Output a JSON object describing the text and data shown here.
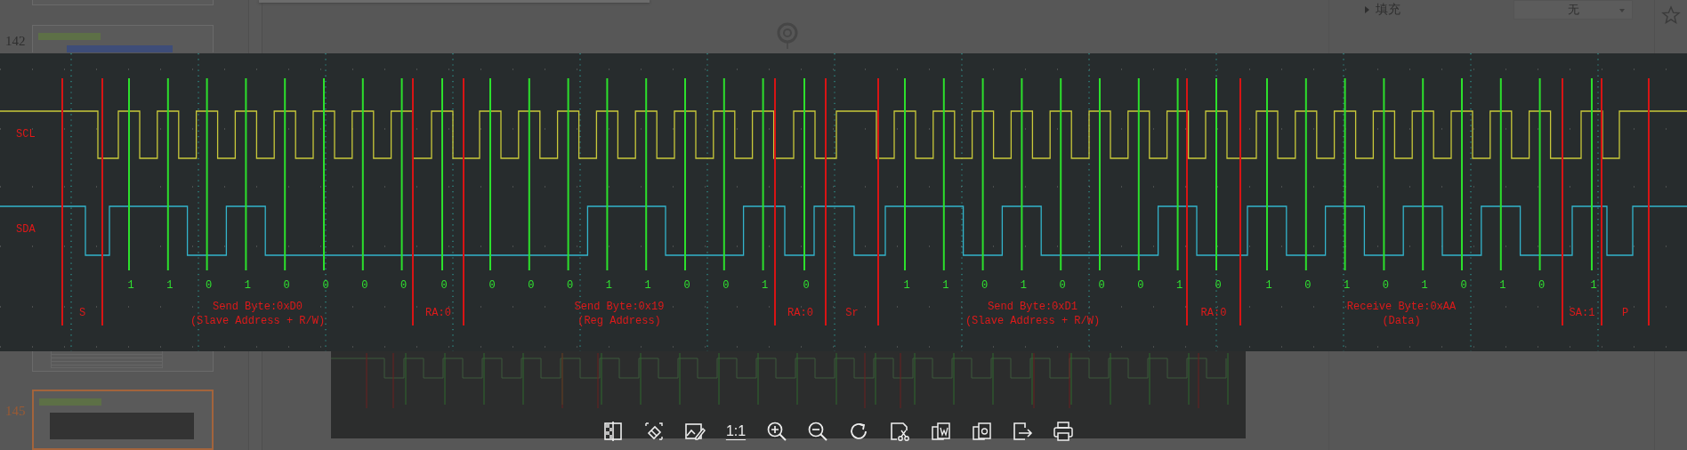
{
  "thumbnails": [
    {
      "number": "142",
      "selected": false
    },
    {
      "number": "145",
      "selected": true
    }
  ],
  "format_panel": {
    "section": "填充",
    "value": "无"
  },
  "viewer": {
    "image": {
      "signals": [
        "SCL",
        "SDA"
      ],
      "segments": [
        {
          "kind": "start",
          "label": "S"
        },
        {
          "kind": "byte",
          "bits": [
            "1",
            "1",
            "0",
            "1",
            "0",
            "0",
            "0",
            "0"
          ],
          "label": "Send Byte:0xD0",
          "note": "(Slave Address + R/W)"
        },
        {
          "kind": "ack",
          "bit": "0",
          "label": "RA:0"
        },
        {
          "kind": "byte",
          "bits": [
            "0",
            "0",
            "0",
            "1",
            "1",
            "0",
            "0",
            "1"
          ],
          "label": "Send Byte:0x19",
          "note": "(Reg Address)"
        },
        {
          "kind": "ack",
          "bit": "0",
          "label": "RA:0"
        },
        {
          "kind": "restart",
          "label": "Sr"
        },
        {
          "kind": "byte",
          "bits": [
            "1",
            "1",
            "0",
            "1",
            "0",
            "0",
            "0",
            "1"
          ],
          "label": "Send Byte:0xD1",
          "note": "(Slave Address + R/W)"
        },
        {
          "kind": "ack",
          "bit": "0",
          "label": "RA:0"
        },
        {
          "kind": "byte",
          "bits": [
            "1",
            "0",
            "1",
            "0",
            "1",
            "0",
            "1",
            "0"
          ],
          "label": "Receive Byte:0xAA",
          "note": "(Data)"
        },
        {
          "kind": "ack",
          "bit": "1",
          "label": "SA:1"
        },
        {
          "kind": "stop",
          "label": "P"
        }
      ]
    },
    "toolbar": [
      {
        "kind": "compare"
      },
      {
        "kind": "eraser"
      },
      {
        "kind": "edit-image"
      },
      {
        "kind": "text",
        "label": "1:1"
      },
      {
        "kind": "zoom-in"
      },
      {
        "kind": "zoom-out"
      },
      {
        "kind": "rotate"
      },
      {
        "kind": "cut"
      },
      {
        "kind": "convert-doc"
      },
      {
        "kind": "convert-image"
      },
      {
        "kind": "export"
      },
      {
        "kind": "print"
      }
    ]
  }
}
